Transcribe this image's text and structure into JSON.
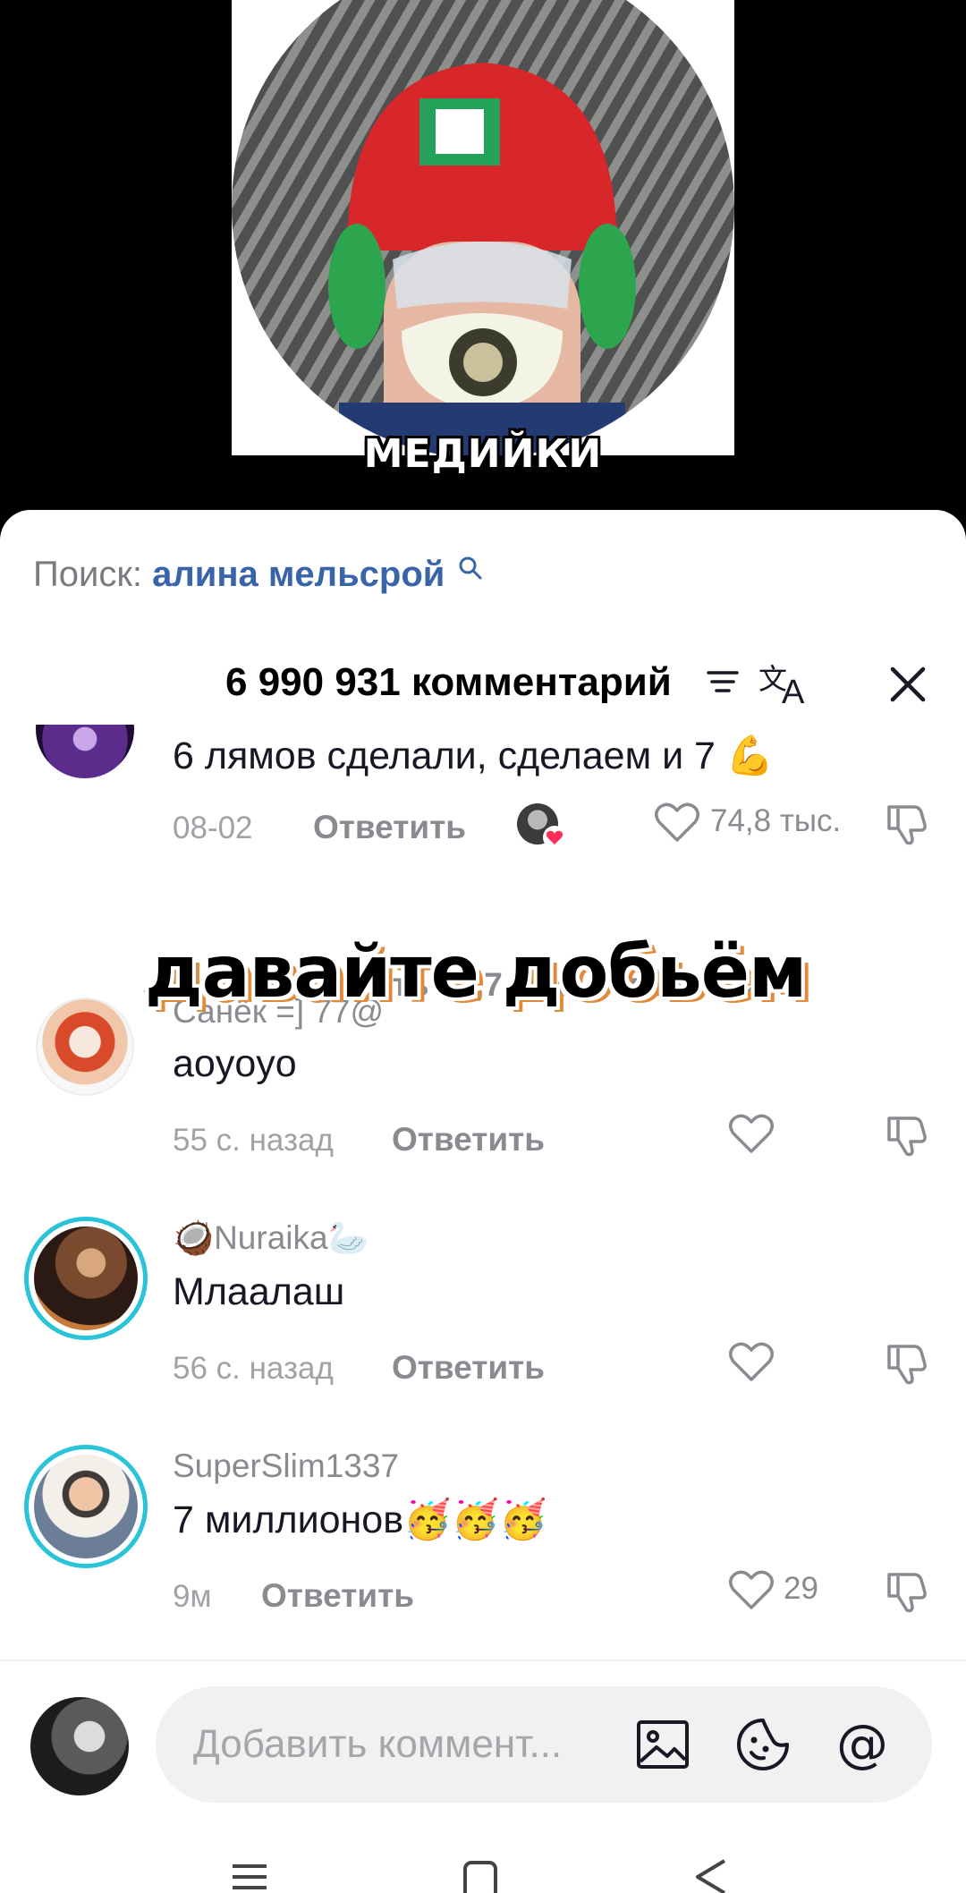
{
  "video": {
    "caption": "МЕДИЙКИ"
  },
  "search": {
    "prefix": "Поиск:",
    "query": "алина мельсрой"
  },
  "header": {
    "comment_count": "6 990 931 комментарий"
  },
  "comments": [
    {
      "text": "6 лямов сделали, сделаем и 7 💪",
      "time": "08-02",
      "reply_label": "Ответить",
      "likes": "74,8 тыс.",
      "view_replies": "Посмотреть 12,7 тыс. ответа"
    },
    {
      "username": "Санёк =] 77@",
      "text": "aoyoyo",
      "time": "55 с. назад",
      "reply_label": "Ответить",
      "likes": ""
    },
    {
      "username": "🥥Nuraika🦢",
      "text": "Млаалаш",
      "time": "56 с. назад",
      "reply_label": "Ответить",
      "likes": ""
    },
    {
      "username": "SuperSlim1337",
      "text": "7 миллионов🥳🥳🥳",
      "time": "9м",
      "reply_label": "Ответить",
      "likes": "29"
    }
  ],
  "overlay": {
    "caption": "давайте добьём"
  },
  "input": {
    "placeholder": "Добавить коммент..."
  },
  "colors": {
    "link": "#3a64a8",
    "ring": "#29c4d8",
    "like_heart_badge": "#fe2c55"
  }
}
